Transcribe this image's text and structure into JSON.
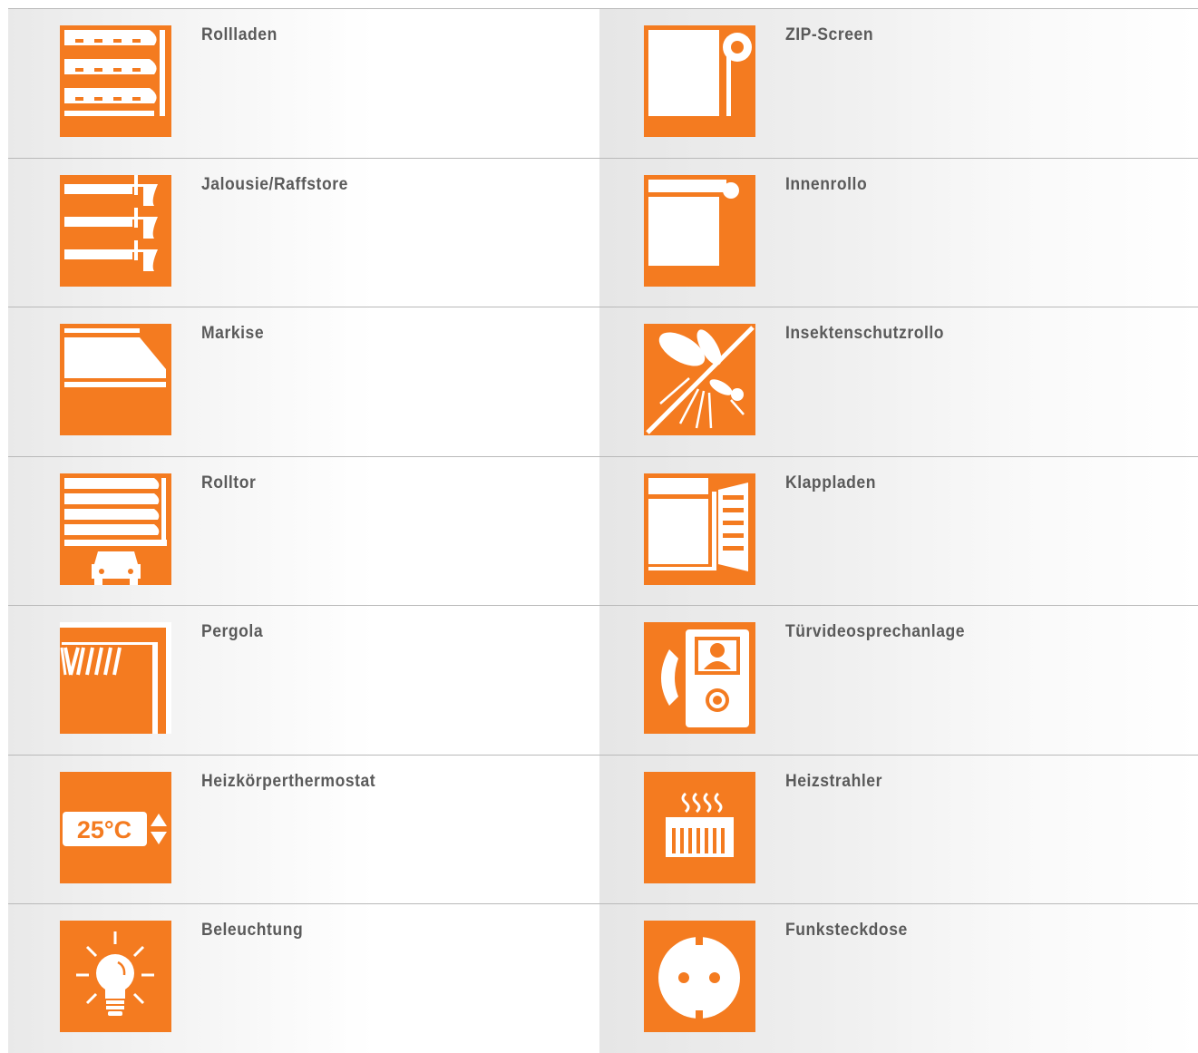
{
  "colors": {
    "accent": "#f47b20",
    "label": "#5a5a5a",
    "divider": "#b9b9b9"
  },
  "rows": [
    {
      "left": {
        "label": "Rollladen",
        "icon": "roller-shutter-icon"
      },
      "right": {
        "label": "ZIP-Screen",
        "icon": "zip-screen-icon"
      }
    },
    {
      "left": {
        "label": "Jalousie/Raffstore",
        "icon": "venetian-blind-icon"
      },
      "right": {
        "label": "Innenrollo",
        "icon": "indoor-roller-blind-icon"
      }
    },
    {
      "left": {
        "label": "Markise",
        "icon": "awning-icon"
      },
      "right": {
        "label": "Insektenschutzrollo",
        "icon": "insect-screen-icon"
      }
    },
    {
      "left": {
        "label": "Rolltor",
        "icon": "roller-door-garage-icon"
      },
      "right": {
        "label": "Klappladen",
        "icon": "folding-shutter-icon"
      }
    },
    {
      "left": {
        "label": "Pergola",
        "icon": "pergola-icon"
      },
      "right": {
        "label": "Türvideosprechanlage",
        "icon": "video-door-phone-icon"
      }
    },
    {
      "left": {
        "label": "Heizkörperthermostat",
        "icon": "radiator-thermostat-icon",
        "display_text": "25°C"
      },
      "right": {
        "label": "Heizstrahler",
        "icon": "radiant-heater-icon"
      }
    },
    {
      "left": {
        "label": "Beleuchtung",
        "icon": "light-bulb-icon"
      },
      "right": {
        "label": "Funksteckdose",
        "icon": "wireless-socket-icon"
      }
    }
  ]
}
